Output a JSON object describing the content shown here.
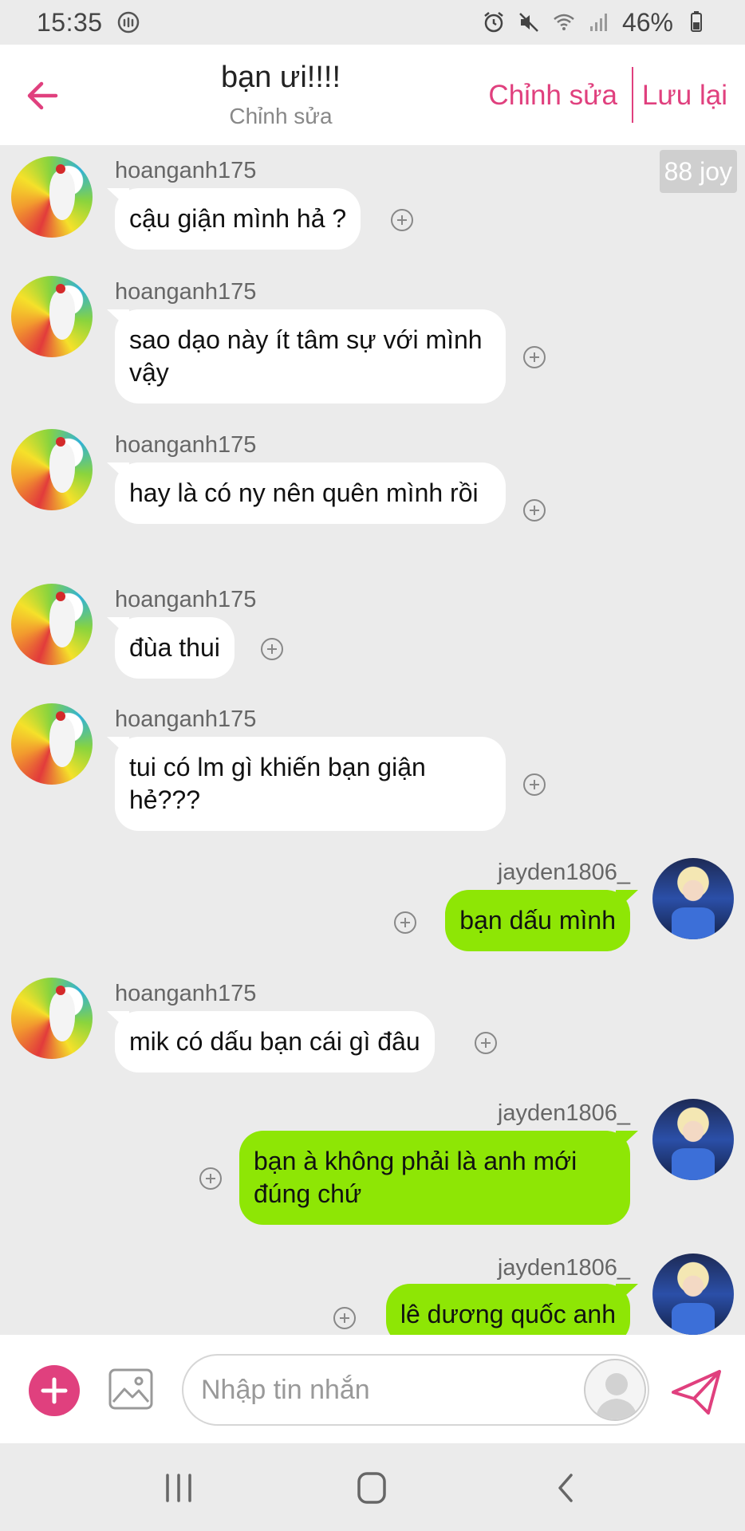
{
  "status_bar": {
    "time": "15:35",
    "battery": "46%"
  },
  "header": {
    "title": "bạn ưi!!!!",
    "subtitle": "Chỉnh sửa",
    "edit_label": "Chỉnh sửa",
    "save_label": "Lưu lại"
  },
  "chat": {
    "joy_badge": "88 joy",
    "messages": [
      {
        "user": "hoanganh175",
        "text": "cậu giận mình hả ?",
        "direction": "in"
      },
      {
        "user": "hoanganh175",
        "text": "sao dạo này ít tâm sự với mình vậy",
        "direction": "in"
      },
      {
        "user": "hoanganh175",
        "text": "hay là có ny nên quên mình rồi",
        "direction": "in"
      },
      {
        "user": "hoanganh175",
        "text": "đùa thui",
        "direction": "in"
      },
      {
        "user": "hoanganh175",
        "text": "tui có lm gì khiến bạn giận hẻ???",
        "direction": "in"
      },
      {
        "user": "jayden1806_",
        "text": "bạn dấu mình",
        "direction": "out"
      },
      {
        "user": "hoanganh175",
        "text": "mik có dấu bạn cái gì đâu",
        "direction": "in"
      },
      {
        "user": "jayden1806_",
        "text": "bạn à không phải là anh mới đúng chứ",
        "direction": "out"
      },
      {
        "user": "jayden1806_",
        "text": "lê dương quốc anh",
        "direction": "out"
      }
    ]
  },
  "input_bar": {
    "placeholder": "Nhập tin nhắn"
  },
  "colors": {
    "accent": "#e0407e",
    "outgoing_bubble": "#8ee605",
    "incoming_bubble": "#ffffff",
    "chat_background": "#ebebeb"
  },
  "icons": {
    "back": "arrow-left-icon",
    "plus": "circle-plus-icon",
    "image": "image-icon",
    "send": "paper-plane-icon"
  }
}
